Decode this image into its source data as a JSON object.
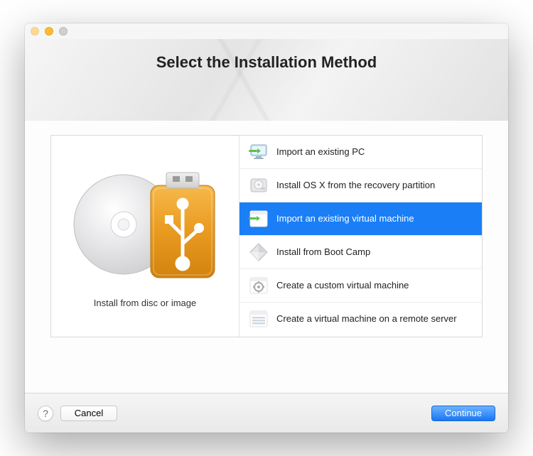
{
  "window": {
    "title": "Select the Installation Method"
  },
  "leftPane": {
    "caption": "Install from disc or image"
  },
  "options": [
    {
      "label": "Import an existing PC",
      "icon": "monitor-import-icon",
      "selected": false
    },
    {
      "label": "Install OS X from the recovery partition",
      "icon": "harddisk-icon",
      "selected": false
    },
    {
      "label": "Import an existing virtual machine",
      "icon": "vm-window-icon",
      "selected": true
    },
    {
      "label": "Install from Boot Camp",
      "icon": "bootcamp-diamond-icon",
      "selected": false
    },
    {
      "label": "Create a custom virtual machine",
      "icon": "custom-gear-icon",
      "selected": false
    },
    {
      "label": "Create a virtual machine on a remote server",
      "icon": "remote-server-icon",
      "selected": false
    }
  ],
  "footer": {
    "help": "?",
    "cancel": "Cancel",
    "continue": "Continue"
  },
  "colors": {
    "selection": "#1a7ef6",
    "primaryButton": "#1977f3"
  }
}
